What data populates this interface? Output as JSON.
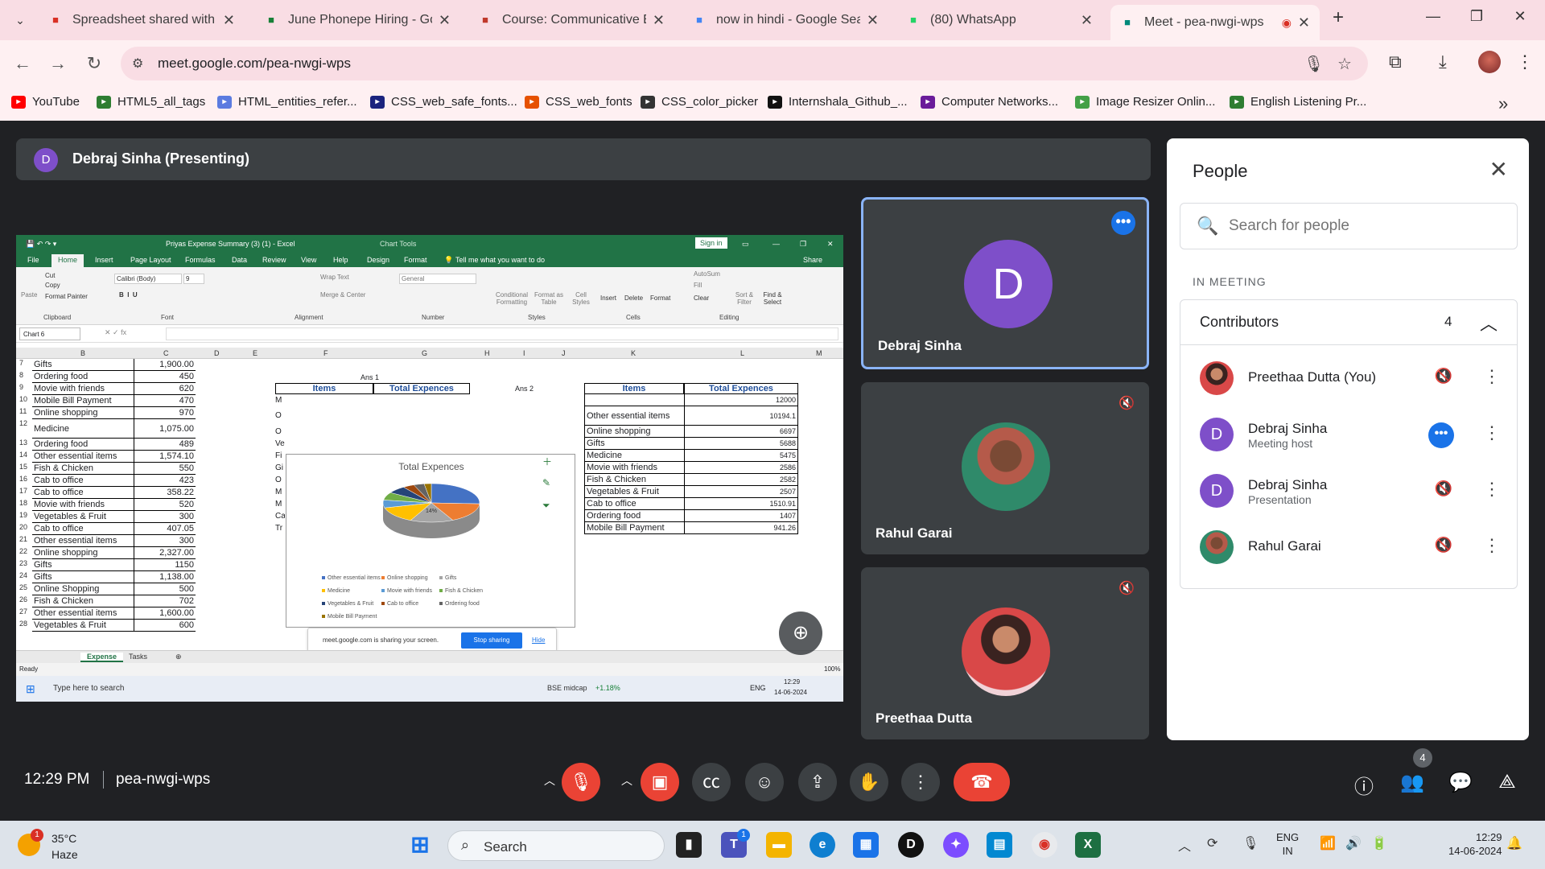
{
  "browser": {
    "tabs": [
      {
        "title": "Spreadsheet shared with y",
        "favicon": "gmail-icon",
        "color": "#d93025"
      },
      {
        "title": "June Phonepe Hiring - Goo",
        "favicon": "sheets-icon",
        "color": "#188038"
      },
      {
        "title": "Course: Communicative En",
        "favicon": "course-icon",
        "color": "#c0392b"
      },
      {
        "title": "now in hindi - Google Sear",
        "favicon": "google-icon",
        "color": "#4285f4"
      },
      {
        "title": "(80) WhatsApp",
        "favicon": "whatsapp-icon",
        "color": "#25d366"
      },
      {
        "title": "Meet - pea-nwgi-wps",
        "favicon": "meet-icon",
        "color": "#00897b"
      }
    ],
    "url": "meet.google.com/pea-nwgi-wps",
    "bookmarks": [
      {
        "label": "YouTube",
        "color": "#ff0000"
      },
      {
        "label": "HTML5_all_tags",
        "color": "#2e7d32"
      },
      {
        "label": "HTML_entities_refer...",
        "color": "#5b7be0"
      },
      {
        "label": "CSS_web_safe_fonts...",
        "color": "#1a237e"
      },
      {
        "label": "CSS_web_fonts",
        "color": "#e65100"
      },
      {
        "label": "CSS_color_picker",
        "color": "#333333"
      },
      {
        "label": "Internshala_Github_...",
        "color": "#111111"
      },
      {
        "label": "Computer Networks...",
        "color": "#6a1b9a"
      },
      {
        "label": "Image Resizer Onlin...",
        "color": "#43a047"
      },
      {
        "label": "English Listening Pr...",
        "color": "#2e7d32"
      }
    ]
  },
  "meet": {
    "presenter_bar": {
      "initial": "D",
      "label": "Debraj Sinha (Presenting)"
    },
    "tiles": [
      {
        "name": "Debraj Sinha",
        "initial": "D"
      },
      {
        "name": "Rahul Garai"
      },
      {
        "name": "Preethaa Dutta"
      }
    ],
    "people_panel": {
      "title": "People",
      "search_placeholder": "Search for people",
      "section": "IN MEETING",
      "group_label": "Contributors",
      "group_count": "4",
      "participants": [
        {
          "name": "Preethaa Dutta (You)",
          "sub": ""
        },
        {
          "name": "Debraj Sinha",
          "sub": "Meeting host",
          "initial": "D"
        },
        {
          "name": "Debraj Sinha",
          "sub": "Presentation",
          "initial": "D"
        },
        {
          "name": "Rahul Garai",
          "sub": ""
        }
      ]
    },
    "bottom": {
      "time": "12:29 PM",
      "code": "pea-nwgi-wps",
      "people_badge": "4"
    }
  },
  "excel": {
    "window_title": "Priyas Expense Summary (3) (1) - Excel",
    "chart_tools": "Chart Tools",
    "sign_in": "Sign in",
    "ribbon_tabs": [
      "File",
      "Home",
      "Insert",
      "Page Layout",
      "Formulas",
      "Data",
      "Review",
      "View",
      "Help",
      "Design",
      "Format"
    ],
    "tell_me": "Tell me what you want to do",
    "share": "Share",
    "ribbon_groups": [
      "Clipboard",
      "Font",
      "Alignment",
      "Number",
      "Styles",
      "Cells",
      "Editing"
    ],
    "clipboard_items": [
      "Cut",
      "Copy",
      "Format Painter",
      "Paste"
    ],
    "font_name": "Calibri (Body)",
    "font_size": "9",
    "number_format": "General",
    "alignment_items": [
      "Wrap Text",
      "Merge & Center"
    ],
    "styles_items": [
      "Conditional Formatting",
      "Format as Table",
      "Cell Styles"
    ],
    "cells_items": [
      "Insert",
      "Delete",
      "Format"
    ],
    "editing_items": [
      "AutoSum",
      "Fill",
      "Clear",
      "Sort & Filter",
      "Find & Select"
    ],
    "name_box": "Chart 6",
    "columns": [
      "B",
      "C",
      "D",
      "E",
      "F",
      "G",
      "H",
      "I",
      "J",
      "K",
      "L",
      "M"
    ],
    "rows_b": [
      {
        "num": "7",
        "item": "Gifts",
        "amount": "1,900.00"
      },
      {
        "num": "8",
        "item": "Ordering food",
        "amount": "450"
      },
      {
        "num": "9",
        "item": "Movie with friends",
        "amount": "620"
      },
      {
        "num": "10",
        "item": "Mobile Bill Payment",
        "amount": "470"
      },
      {
        "num": "11",
        "item": "Online shopping",
        "amount": "970"
      },
      {
        "num": "12",
        "item": "Medicine",
        "amount": "1,075.00"
      },
      {
        "num": "13",
        "item": "Ordering food",
        "amount": "489"
      },
      {
        "num": "14",
        "item": "Other essential items",
        "amount": "1,574.10"
      },
      {
        "num": "15",
        "item": "Fish & Chicken",
        "amount": "550"
      },
      {
        "num": "16",
        "item": "Cab to office",
        "amount": "423"
      },
      {
        "num": "17",
        "item": "Cab to office",
        "amount": "358.22"
      },
      {
        "num": "18",
        "item": "Movie with friends",
        "amount": "520"
      },
      {
        "num": "19",
        "item": "Vegetables & Fruit",
        "amount": "300"
      },
      {
        "num": "20",
        "item": "Cab to office",
        "amount": "407.05"
      },
      {
        "num": "21",
        "item": "Other essential items",
        "amount": "300"
      },
      {
        "num": "22",
        "item": "Online shopping",
        "amount": "2,327.00"
      },
      {
        "num": "23",
        "item": "Gifts",
        "amount": "1150"
      },
      {
        "num": "24",
        "item": "Gifts",
        "amount": "1,138.00"
      },
      {
        "num": "25",
        "item": "Online Shopping",
        "amount": "500"
      },
      {
        "num": "26",
        "item": "Fish & Chicken",
        "amount": "702"
      },
      {
        "num": "27",
        "item": "Other essential items",
        "amount": "1,600.00"
      },
      {
        "num": "28",
        "item": "Vegetables & Fruit",
        "amount": "600"
      }
    ],
    "ans1": "Ans 1",
    "ans2": "Ans 2",
    "table_headers": [
      "Items",
      "Total Expences"
    ],
    "f_column_partial": [
      "M",
      "O",
      "O",
      "Ve",
      "Fi",
      "Gi",
      "O",
      "M",
      "M",
      "Ca",
      "Tr"
    ],
    "k_rows": [
      {
        "item": "",
        "total": "12000"
      },
      {
        "item": "Other essential items",
        "total": "10194.1"
      },
      {
        "item": "Online shopping",
        "total": "6697"
      },
      {
        "item": "Gifts",
        "total": "5688"
      },
      {
        "item": "Medicine",
        "total": "5475"
      },
      {
        "item": "Movie with friends",
        "total": "2586"
      },
      {
        "item": "Fish & Chicken",
        "total": "2582"
      },
      {
        "item": "Vegetables & Fruit",
        "total": "2507"
      },
      {
        "item": "Cab to office",
        "total": "1510.91"
      },
      {
        "item": "Ordering food",
        "total": "1407"
      },
      {
        "item": "Mobile Bill Payment",
        "total": "941.26"
      }
    ],
    "chart": {
      "title": "Total Expences",
      "legend": [
        "Other essential items",
        "Online shopping",
        "Gifts",
        "Medicine",
        "Movie with friends",
        "Fish & Chicken",
        "Vegetables & Fruit",
        "Cab to office",
        "Ordering food",
        "Mobile Bill Payment"
      ],
      "legend_colors": [
        "#4472c4",
        "#ed7d31",
        "#a5a5a5",
        "#ffc000",
        "#5b9bd5",
        "#70ad47",
        "#264478",
        "#9e480e",
        "#636363",
        "#997300"
      ],
      "slice_label": "14%"
    },
    "share_notice": "meet.google.com is sharing your screen.",
    "stop_sharing": "Stop sharing",
    "hide": "Hide",
    "sheet_tabs": [
      "Expense",
      "Tasks"
    ],
    "status": "Ready",
    "zoom": "100%",
    "inner_taskbar": {
      "search": "Type here to search",
      "ticker": "BSE midcap",
      "ticker_change": "+1.18%",
      "lang": "ENG",
      "time": "12:29",
      "date": "14-06-2024"
    }
  },
  "taskbar": {
    "weather_temp": "35°C",
    "weather_desc": "Haze",
    "weather_badge": "1",
    "search": "Search",
    "teams_badge": "1",
    "lang1": "ENG",
    "lang2": "IN",
    "time": "12:29",
    "date": "14-06-2024"
  }
}
